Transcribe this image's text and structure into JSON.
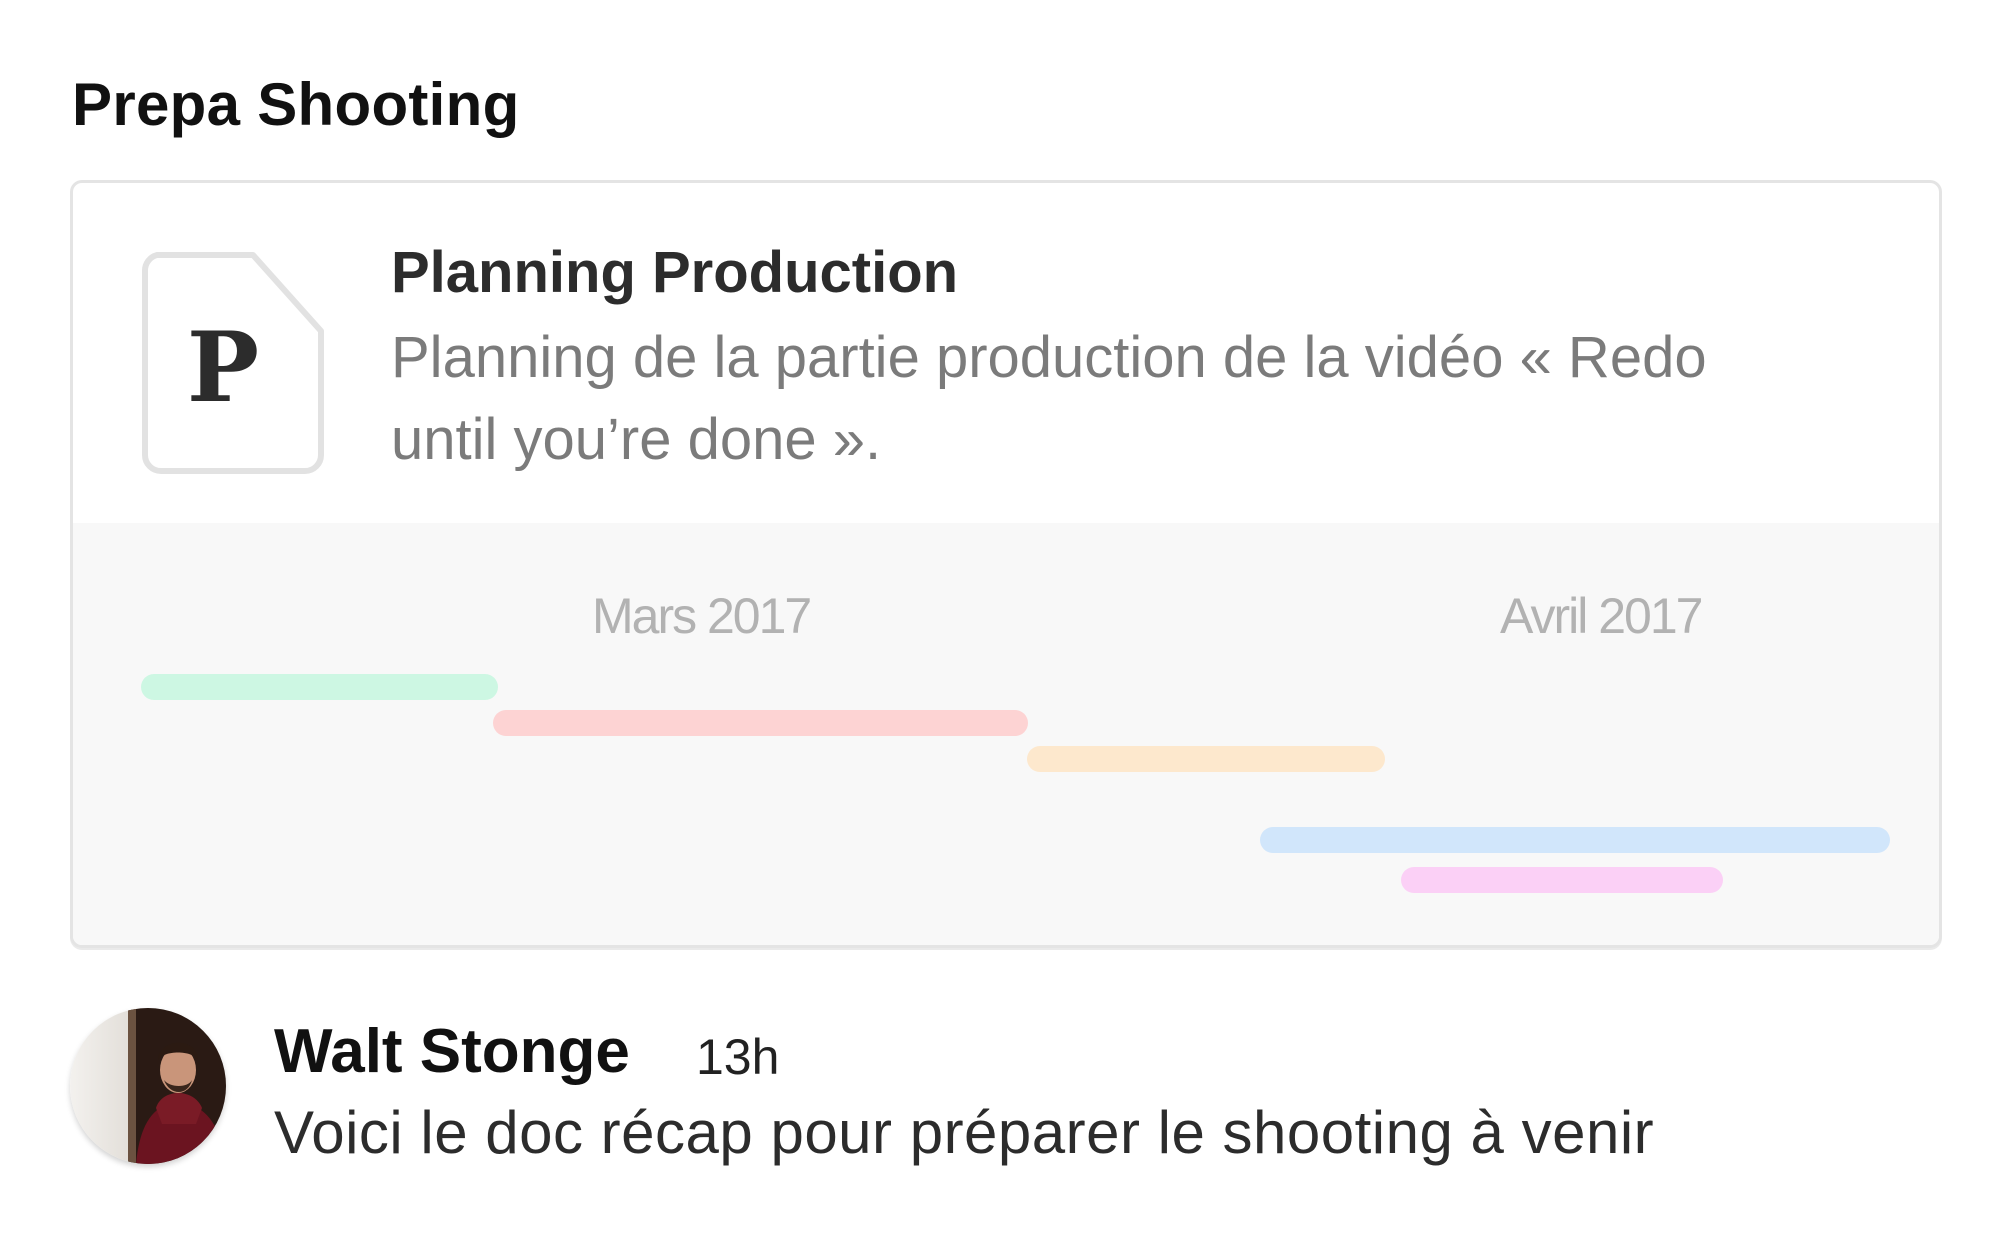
{
  "section": {
    "title": "Prepa Shooting"
  },
  "document": {
    "icon_letter": "P",
    "title": "Planning Production",
    "description": "Planning de la partie production de la vidéo « Redo until you’re done ».",
    "timeline": {
      "months": [
        "Mars 2017",
        "Avril 2017"
      ],
      "bar_colors": [
        "#cdf7e3",
        "#fdd3d3",
        "#fde8cd",
        "#d1e6fb",
        "#fbd0f6"
      ]
    }
  },
  "comment": {
    "author": "Walt Stonge",
    "time": "13h",
    "text": "Voici le doc récap pour préparer le shooting à venir"
  },
  "colors": {
    "card_border": "#e4e4e4",
    "timeline_background": "#f8f8f8",
    "muted_text": "#7b7b7b"
  }
}
